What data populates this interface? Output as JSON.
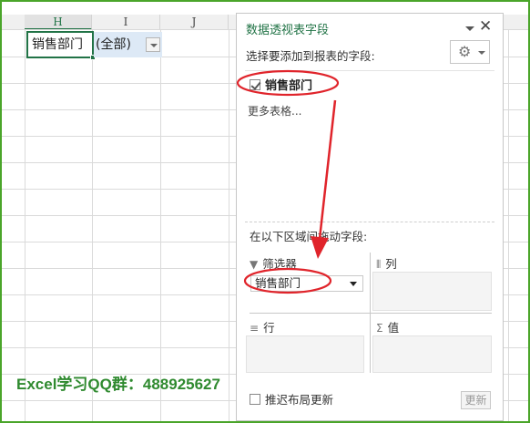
{
  "sheet": {
    "columns": [
      "H",
      "I",
      "J"
    ],
    "cells": {
      "h2": "销售部门",
      "i2": "(全部)"
    }
  },
  "watermark": "Excel学习QQ群：488925627",
  "pane": {
    "title": "数据透视表字段",
    "subtitle": "选择要添加到报表的字段:",
    "fields": [
      {
        "label": "销售部门",
        "checked": true
      }
    ],
    "more_tables": "更多表格...",
    "drag_label": "在以下区域间拖动字段:",
    "areas": {
      "filters": {
        "label": "筛选器",
        "field": "销售部门"
      },
      "columns": {
        "label": "列"
      },
      "rows": {
        "label": "行"
      },
      "values": {
        "label": "值"
      }
    },
    "defer_label": "推迟布局更新",
    "update_label": "更新"
  },
  "colors": {
    "accent_green": "#217346",
    "annotation_red": "#e0242b",
    "watermark_green": "#2f8a2f",
    "selected_cell_fill": "#dde9f6"
  },
  "icons": {
    "gear": "gear-icon",
    "close": "close-icon",
    "filter": "filter-icon",
    "columns": "columns-icon",
    "rows": "rows-icon",
    "sigma": "sigma-icon"
  }
}
